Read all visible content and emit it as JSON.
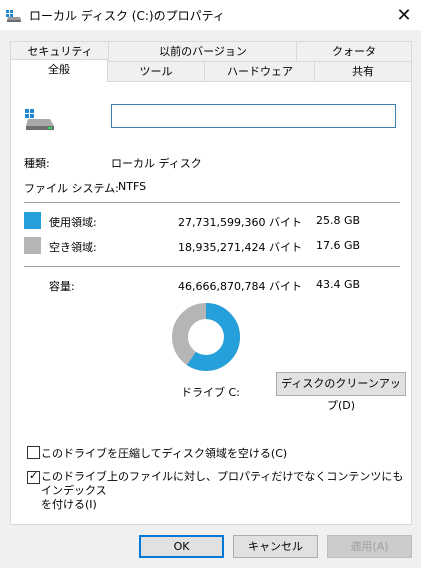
{
  "window": {
    "title": "ローカル ディスク (C:)のプロパティ",
    "close_glyph": "✕",
    "drive_icon": "drive-icon"
  },
  "tabs_row1": [
    "セキュリティ",
    "以前のバージョン",
    "クォータ"
  ],
  "tabs_row2": [
    "全般",
    "ツール",
    "ハードウェア",
    "共有"
  ],
  "active_tab": "全般",
  "general": {
    "name_value": "",
    "type_label": "種類:",
    "type_value": "ローカル ディスク",
    "fs_label": "ファイル システム:",
    "fs_value": "NTFS",
    "used": {
      "label": "使用領域:",
      "bytes": "27,731,599,360 バイト",
      "size": "25.8 GB",
      "color": "#26a0da"
    },
    "free": {
      "label": "空き領域:",
      "bytes": "18,935,271,424 バイト",
      "size": "17.6 GB",
      "color": "#b5b5b5"
    },
    "capacity": {
      "label": "容量:",
      "bytes": "46,666,870,784 バイト",
      "size": "43.4 GB"
    },
    "used_fraction": 0.594,
    "drive_label": "ドライブ C:",
    "cleanup_button": "ディスクのクリーンアップ(D)",
    "compress_label": "このドライブを圧縮してディスク領域を空ける(C)",
    "compress_checked": false,
    "index_label_line1": "このドライブ上のファイルに対し、プロパティだけでなくコンテンツにもインデックス",
    "index_label_line2": "を付ける(I)",
    "index_checked": true
  },
  "buttons": {
    "ok": "OK",
    "cancel": "キャンセル",
    "apply": "適用(A)"
  }
}
